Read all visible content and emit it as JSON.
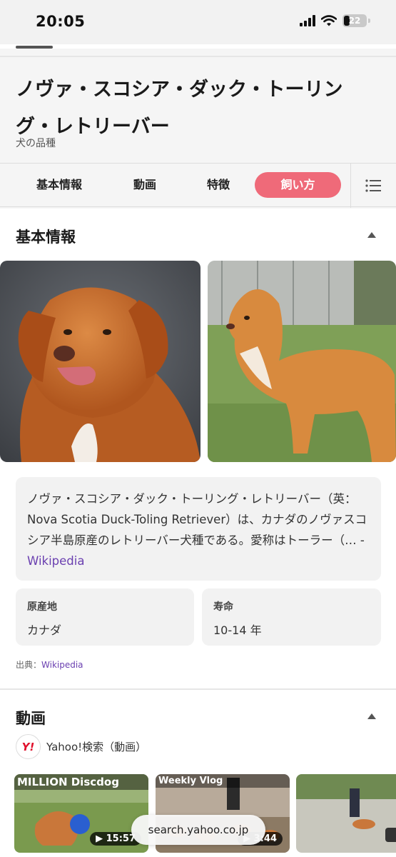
{
  "status_bar": {
    "time": "20:05",
    "battery": "22"
  },
  "header": {
    "title": "ノヴァ・スコシア・ダック・トーリング・レトリーバー",
    "subtitle": "犬の品種"
  },
  "nav": {
    "tabs": [
      {
        "label": "基本情報"
      },
      {
        "label": "動画"
      },
      {
        "label": "特徴"
      },
      {
        "label": "飼い方"
      }
    ],
    "active_color": "#ef6a79"
  },
  "basic_info": {
    "title": "基本情報",
    "description": "ノヴァ・スコシア・ダック・トーリング・レトリーバー（英：Nova Scotia Duck-Toling Retriever）は、カナダのノヴァスコシア半島原産のレトリーバー犬種である。愛称はトーラー（… - ",
    "description_link": "Wikipedia",
    "facts": [
      {
        "label": "原産地",
        "value": "カナダ"
      },
      {
        "label": "寿命",
        "value": "10-14 年"
      }
    ],
    "source_prefix": "出典：",
    "source_link": "Wikipedia"
  },
  "videos": {
    "title": "動画",
    "provider": "Yahoo!検索（動画）",
    "items": [
      {
        "title": "MILLION Discdog",
        "duration": "15:57"
      },
      {
        "title": "Weekly Vlog",
        "duration": "3:44"
      },
      {
        "title": "",
        "duration": ""
      }
    ]
  },
  "browser": {
    "url": "search.yahoo.co.jp"
  },
  "colors": {
    "link": "#6a3fb0",
    "accent": "#ef6a79"
  }
}
